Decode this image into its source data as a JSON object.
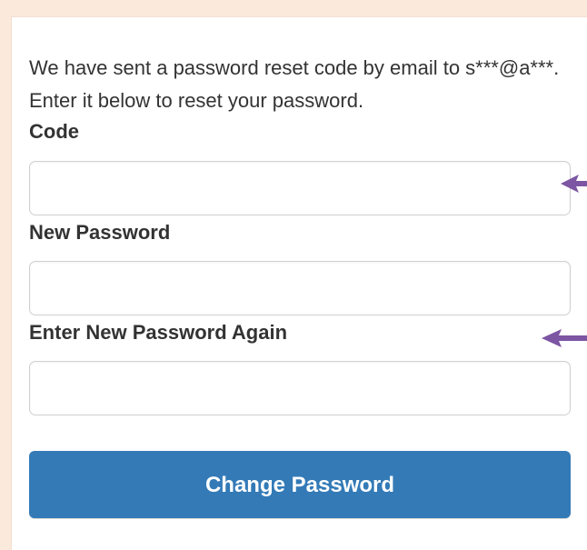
{
  "form": {
    "message": "We have sent a password reset code by email to s***@a***. Enter it below to reset your password.",
    "fields": {
      "code": {
        "label": "Code",
        "value": "",
        "placeholder": ""
      },
      "new_password": {
        "label": "New Password",
        "value": "",
        "placeholder": ""
      },
      "confirm_password": {
        "label": "Enter New Password Again",
        "value": "",
        "placeholder": ""
      }
    },
    "button_label": "Change Password"
  },
  "annotations": {
    "arrow_icon": "arrow-left-icon",
    "arrow_color": "#7c55a3"
  },
  "colors": {
    "button": "#337ab7",
    "page_background": "#fbe9dc"
  }
}
